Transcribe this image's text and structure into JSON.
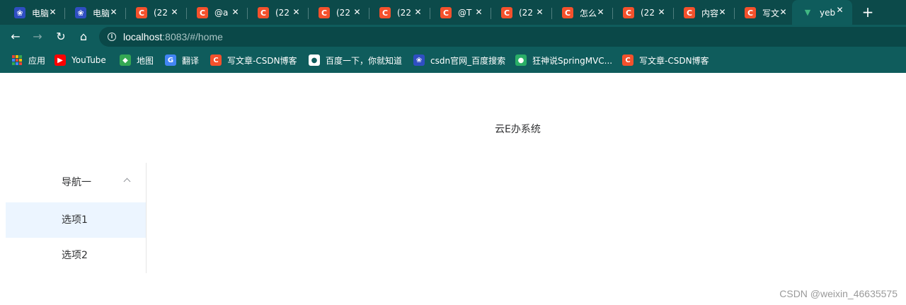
{
  "browser": {
    "tabs": [
      {
        "favicon": "baidu-paw-icon",
        "title": "电脑",
        "active": false
      },
      {
        "favicon": "baidu-paw-icon",
        "title": "电脑",
        "active": false
      },
      {
        "favicon": "csdn-c-icon",
        "title": "(22",
        "active": false
      },
      {
        "favicon": "csdn-c-icon",
        "title": "@a",
        "active": false
      },
      {
        "favicon": "csdn-c-icon",
        "title": "(22",
        "active": false
      },
      {
        "favicon": "csdn-c-icon",
        "title": "(22",
        "active": false
      },
      {
        "favicon": "csdn-c-icon",
        "title": "(22",
        "active": false
      },
      {
        "favicon": "csdn-c-icon",
        "title": "@T",
        "active": false
      },
      {
        "favicon": "csdn-c-icon",
        "title": "(22",
        "active": false
      },
      {
        "favicon": "csdn-c-icon",
        "title": "怎么",
        "active": false
      },
      {
        "favicon": "csdn-c-icon",
        "title": "(22",
        "active": false
      },
      {
        "favicon": "csdn-c-icon",
        "title": "内容",
        "active": false
      },
      {
        "favicon": "csdn-c-icon",
        "title": "写文",
        "active": false
      },
      {
        "favicon": "vue-logo-icon",
        "title": "yeb",
        "active": true
      }
    ],
    "close_glyph": "✕",
    "new_tab_glyph": "+",
    "address": {
      "host": "localhost",
      "path": ":8083/#/home"
    },
    "bookmarks": [
      {
        "icon": "apps-grid-icon",
        "label": "应用"
      },
      {
        "icon": "youtube-icon",
        "label": "YouTube"
      },
      {
        "icon": "maps-icon",
        "label": "地图"
      },
      {
        "icon": "translate-icon",
        "label": "翻译"
      },
      {
        "icon": "csdn-c-icon",
        "label": "写文章-CSDN博客"
      },
      {
        "icon": "globe-icon",
        "label": "百度一下，你就知道"
      },
      {
        "icon": "baidu-paw-icon",
        "label": "csdn官网_百度搜索"
      },
      {
        "icon": "wechat-icon",
        "label": "狂神说SpringMVC..."
      },
      {
        "icon": "csdn-c-icon",
        "label": "写文章-CSDN博客"
      }
    ],
    "theme_colors": {
      "tabstrip": "#0c4a4a",
      "toolbar": "#0f5c5c",
      "omnibox": "#0a4848"
    }
  },
  "page": {
    "title": "云E办系统",
    "menu": {
      "submenu_title": "导航一",
      "items": [
        {
          "label": "选项1",
          "active": true
        },
        {
          "label": "选项2",
          "active": false
        }
      ],
      "active_bg": "#ecf5ff"
    },
    "watermark": "CSDN @weixin_46635575"
  }
}
